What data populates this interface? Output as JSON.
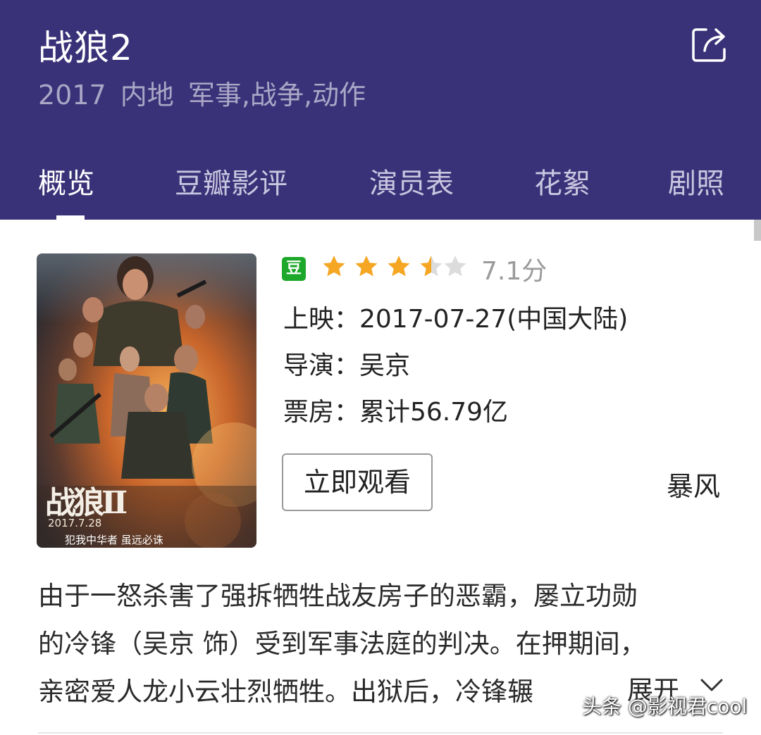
{
  "header": {
    "title": "战狼2",
    "subtitle": "2017  内地  军事,战争,动作",
    "share_icon": "share-icon"
  },
  "tabs": [
    {
      "label": "概览",
      "active": true
    },
    {
      "label": "豆瓣影评",
      "active": false
    },
    {
      "label": "演员表",
      "active": false
    },
    {
      "label": "花絮",
      "active": false
    },
    {
      "label": "剧照",
      "active": false
    }
  ],
  "poster": {
    "date": "2017.7.28",
    "slogan": "犯我中华者 虽远必诛",
    "logo": "战狼II"
  },
  "rating": {
    "badge": "豆",
    "stars_value": 3.5,
    "stars_max": 5,
    "score_text": "7.1分"
  },
  "info": {
    "release": "上映：2017-07-27(中国大陆)",
    "director": "导演：吴京",
    "box_office": "票房：累计56.79亿"
  },
  "actions": {
    "watch_label": "立即观看",
    "source_label": "暴风"
  },
  "description": {
    "lines": [
      "由于一怒杀害了强拆牺牲战友房子的恶霸，屡立功勋",
      "的冷锋（吴京 饰）受到军事法庭的判决。在押期间，",
      "亲密爱人龙小云壮烈牺牲。出狱后，冷锋辗"
    ],
    "expand_label": "展开"
  },
  "watermark": "头条 @影视君cool",
  "colors": {
    "header_bg": "#3a3278",
    "douban_green": "#1ea82b",
    "star_gold": "#f5a623",
    "star_gray": "#dcdcdc"
  }
}
